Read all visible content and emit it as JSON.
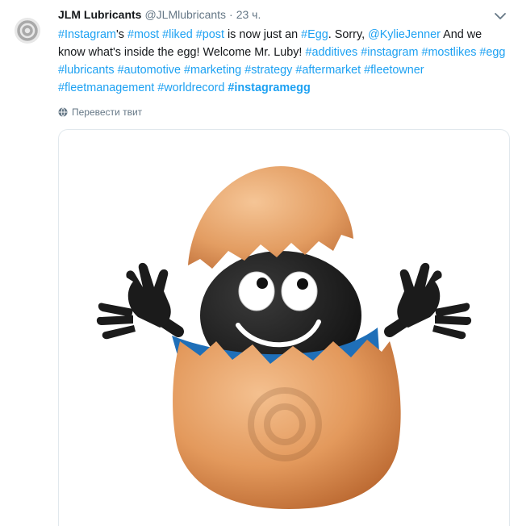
{
  "tweet": {
    "author_name": "JLM Lubricants",
    "author_handle": "@JLMlubricants",
    "separator": "·",
    "timestamp": "23 ч.",
    "text": [
      {
        "t": "#Instagram",
        "k": "tag"
      },
      {
        "t": "'s ",
        "k": "plain"
      },
      {
        "t": "#most",
        "k": "tag"
      },
      {
        "t": " ",
        "k": "plain"
      },
      {
        "t": "#liked",
        "k": "tag"
      },
      {
        "t": " ",
        "k": "plain"
      },
      {
        "t": "#post",
        "k": "tag"
      },
      {
        "t": " is now just an ",
        "k": "plain"
      },
      {
        "t": "#Egg",
        "k": "tag"
      },
      {
        "t": ". Sorry, ",
        "k": "plain"
      },
      {
        "t": "@KylieJenner",
        "k": "mention"
      },
      {
        "t": " And we know what's inside the egg! Welcome Mr. Luby! ",
        "k": "plain"
      },
      {
        "t": "#additives",
        "k": "tag"
      },
      {
        "t": " ",
        "k": "plain"
      },
      {
        "t": "#instagram",
        "k": "tag"
      },
      {
        "t": " ",
        "k": "plain"
      },
      {
        "t": "#mostlikes",
        "k": "tag"
      },
      {
        "t": " ",
        "k": "plain"
      },
      {
        "t": "#egg",
        "k": "tag"
      },
      {
        "t": " ",
        "k": "plain"
      },
      {
        "t": "#lubricants",
        "k": "tag"
      },
      {
        "t": " ",
        "k": "plain"
      },
      {
        "t": "#automotive",
        "k": "tag"
      },
      {
        "t": " ",
        "k": "plain"
      },
      {
        "t": "#marketing",
        "k": "tag"
      },
      {
        "t": " ",
        "k": "plain"
      },
      {
        "t": "#strategy",
        "k": "tag"
      },
      {
        "t": " ",
        "k": "plain"
      },
      {
        "t": "#aftermarket",
        "k": "tag"
      },
      {
        "t": " ",
        "k": "plain"
      },
      {
        "t": "#fleetowner",
        "k": "tag"
      },
      {
        "t": " ",
        "k": "plain"
      },
      {
        "t": "#fleetmanagement",
        "k": "tag"
      },
      {
        "t": " ",
        "k": "plain"
      },
      {
        "t": "#worldrecord",
        "k": "tag"
      },
      {
        "t": " ",
        "k": "plain"
      },
      {
        "t": "#instagramegg",
        "k": "tag-bold"
      }
    ],
    "translate_label": "Перевести твит"
  },
  "icons": {
    "avatar": "jlm-logo-icon",
    "menu": "chevron-down-icon",
    "translate": "globe-icon"
  },
  "colors": {
    "link": "#1da1f2",
    "muted": "#657786",
    "text": "#14171a",
    "egg": "#e39a5e",
    "character": "#1a1a1a",
    "scarf": "#1f6fb8"
  }
}
